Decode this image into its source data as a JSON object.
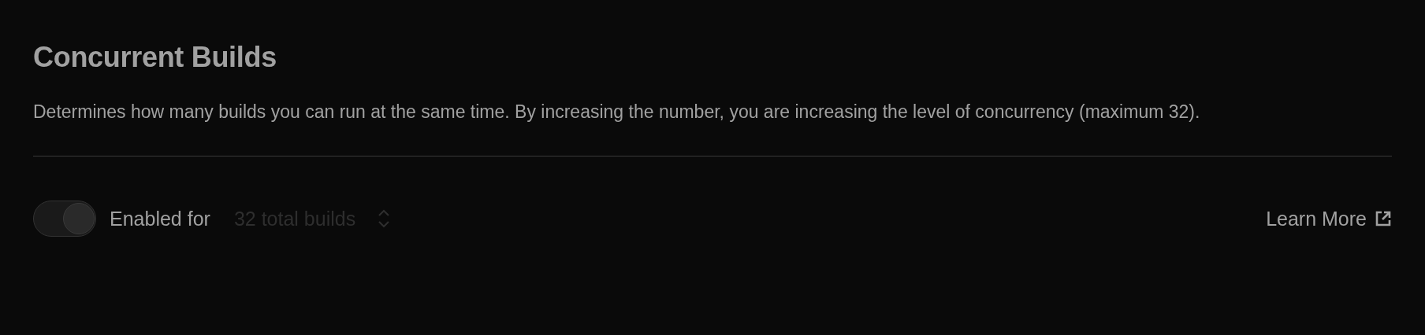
{
  "title": "Concurrent Builds",
  "description": "Determines how many builds you can run at the same time. By increasing the number, you are increasing the level of concurrency (maximum 32).",
  "toggle": {
    "on": true,
    "disabled": true,
    "label": "Enabled for"
  },
  "select": {
    "value": "32 total builds",
    "disabled": true
  },
  "link": {
    "label": "Learn More"
  }
}
